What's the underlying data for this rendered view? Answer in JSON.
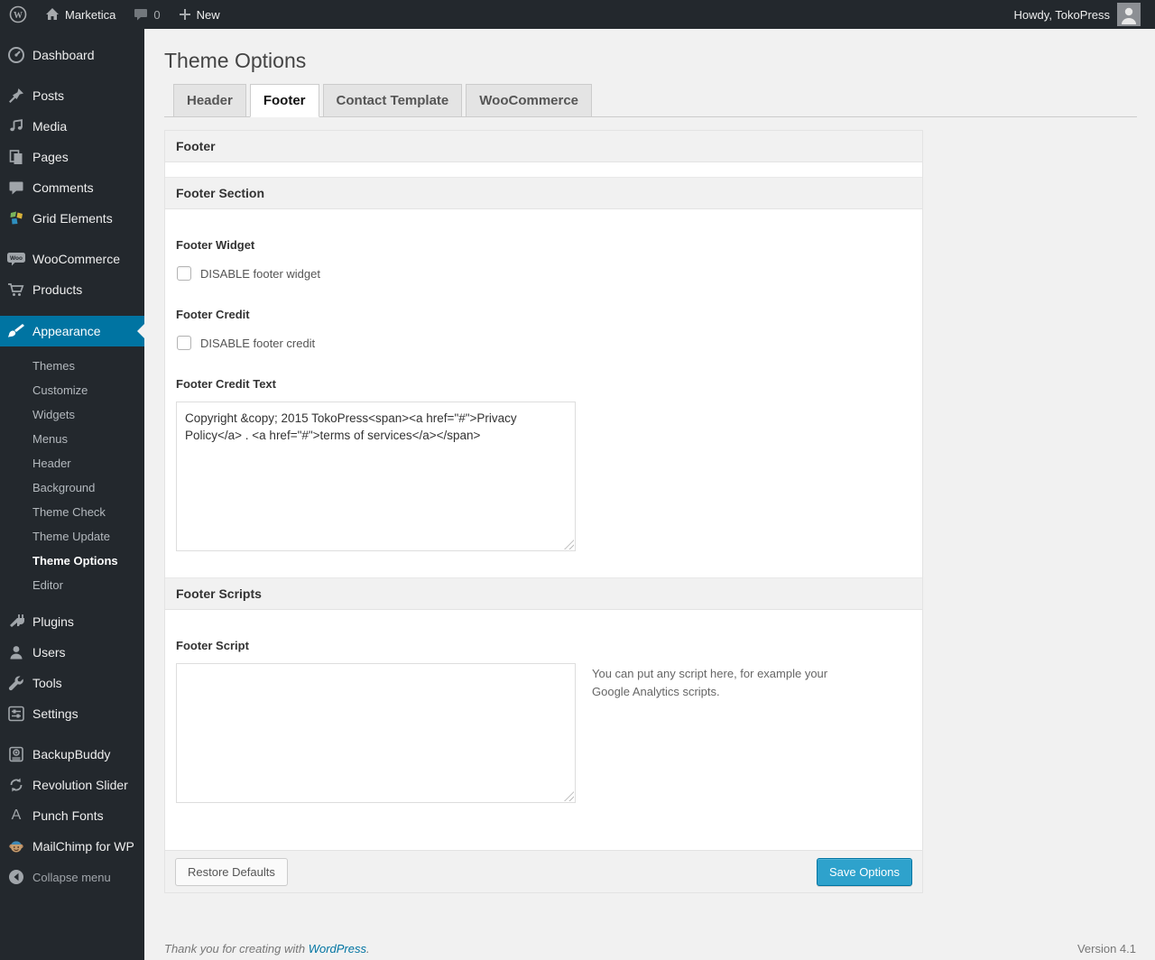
{
  "admin_bar": {
    "site_name": "Marketica",
    "comments_count": "0",
    "new_label": "New",
    "howdy": "Howdy, TokoPress"
  },
  "sidebar": {
    "items": [
      {
        "label": "Dashboard"
      },
      {
        "label": "Posts"
      },
      {
        "label": "Media"
      },
      {
        "label": "Pages"
      },
      {
        "label": "Comments"
      },
      {
        "label": "Grid Elements"
      },
      {
        "label": "WooCommerce"
      },
      {
        "label": "Products"
      },
      {
        "label": "Appearance"
      },
      {
        "label": "Plugins"
      },
      {
        "label": "Users"
      },
      {
        "label": "Tools"
      },
      {
        "label": "Settings"
      },
      {
        "label": "BackupBuddy"
      },
      {
        "label": "Revolution Slider"
      },
      {
        "label": "Punch Fonts"
      },
      {
        "label": "MailChimp for WP"
      }
    ],
    "appearance_submenu": [
      {
        "label": "Themes",
        "current": false
      },
      {
        "label": "Customize",
        "current": false
      },
      {
        "label": "Widgets",
        "current": false
      },
      {
        "label": "Menus",
        "current": false
      },
      {
        "label": "Header",
        "current": false
      },
      {
        "label": "Background",
        "current": false
      },
      {
        "label": "Theme Check",
        "current": false
      },
      {
        "label": "Theme Update",
        "current": false
      },
      {
        "label": "Theme Options",
        "current": true
      },
      {
        "label": "Editor",
        "current": false
      }
    ],
    "collapse_label": "Collapse menu"
  },
  "page": {
    "title": "Theme Options",
    "tabs": [
      {
        "label": "Header",
        "active": false
      },
      {
        "label": "Footer",
        "active": true
      },
      {
        "label": "Contact Template",
        "active": false
      },
      {
        "label": "WooCommerce",
        "active": false
      }
    ]
  },
  "panel": {
    "box_title": "Footer",
    "footer_section_title": "Footer Section",
    "footer_widget_label": "Footer Widget",
    "footer_widget_checkbox_label": "DISABLE footer widget",
    "footer_widget_checked": false,
    "footer_credit_label": "Footer Credit",
    "footer_credit_checkbox_label": "DISABLE footer credit",
    "footer_credit_checked": false,
    "footer_credit_text_label": "Footer Credit Text",
    "footer_credit_text_value": "Copyright &copy; 2015 TokoPress<span><a href=\"#\">Privacy Policy</a> . <a href=\"#\">terms of services</a></span>",
    "footer_scripts_title": "Footer Scripts",
    "footer_script_label": "Footer Script",
    "footer_script_value": "",
    "footer_script_help": "You can put any script here, for example your Google Analytics scripts.",
    "restore_button_label": "Restore Defaults",
    "save_button_label": "Save Options"
  },
  "footer": {
    "thanks_prefix": "Thank you for creating with ",
    "wordpress_link": "WordPress",
    "thanks_suffix": ".",
    "version": "Version 4.1"
  },
  "colors": {
    "accent_blue": "#0074a2",
    "primary_button": "#2ea2cc",
    "admin_dark": "#23282d",
    "content_background": "#f1f1f1"
  }
}
